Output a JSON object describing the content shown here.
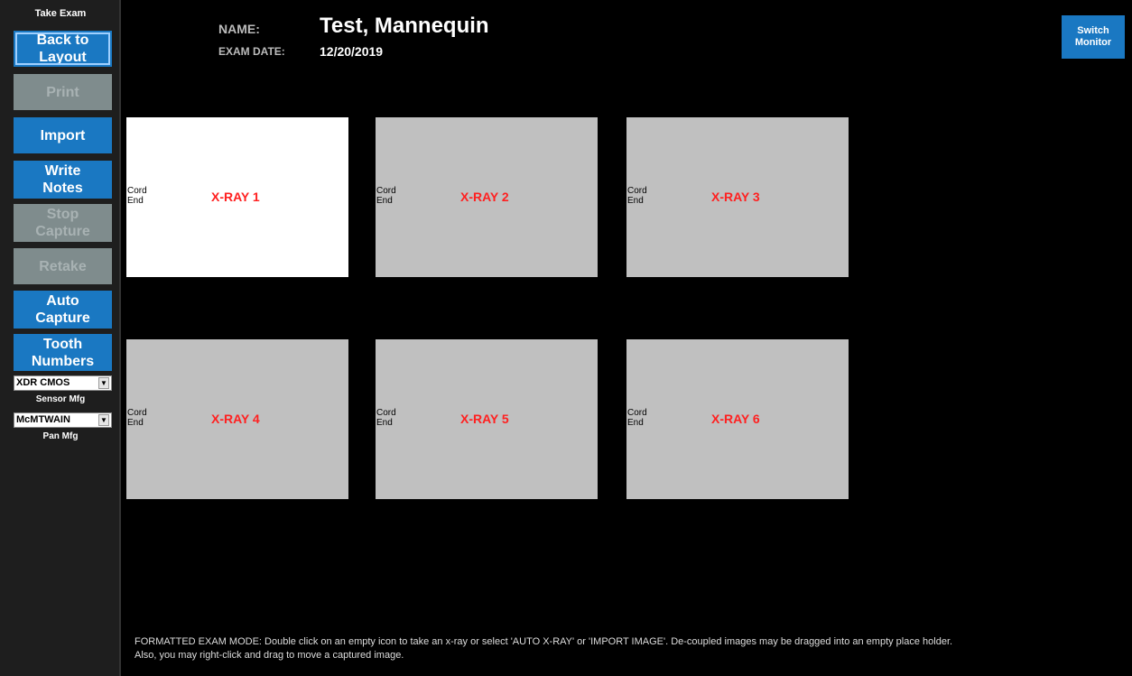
{
  "sidebar": {
    "title": "Take Exam",
    "buttons": {
      "back": "Back to\nLayout",
      "print": "Print",
      "import": "Import",
      "write_notes": "Write\nNotes",
      "stop_capture": "Stop\nCapture",
      "retake": "Retake",
      "auto_capture": "Auto\nCapture",
      "tooth_numbers": "Tooth\nNumbers"
    },
    "sensor_select": {
      "value": "XDR CMOS",
      "caption": "Sensor Mfg"
    },
    "pan_select": {
      "value": "McMTWAIN",
      "caption": "Pan Mfg"
    }
  },
  "header": {
    "name_label": "NAME:",
    "name_value": "Test, Mannequin",
    "date_label": "EXAM DATE:",
    "date_value": "12/20/2019",
    "switch_monitor": "Switch\nMonitor"
  },
  "xrays": [
    {
      "label": "X-RAY 1",
      "cord": "Cord\nEnd"
    },
    {
      "label": "X-RAY 2",
      "cord": "Cord\nEnd"
    },
    {
      "label": "X-RAY 3",
      "cord": "Cord\nEnd"
    },
    {
      "label": "X-RAY 4",
      "cord": "Cord\nEnd"
    },
    {
      "label": "X-RAY 5",
      "cord": "Cord\nEnd"
    },
    {
      "label": "X-RAY 6",
      "cord": "Cord\nEnd"
    }
  ],
  "footer": {
    "instructions": "FORMATTED EXAM MODE: Double click on an empty icon to take an x-ray or select 'AUTO X-RAY' or 'IMPORT IMAGE'. De-coupled images may be dragged into an empty place holder.\nAlso, you may right-click and drag to move a captured image."
  },
  "colors": {
    "button_blue": "#1a78c2",
    "disabled_gray": "#7f8c8d",
    "xray_label_red": "#ff2020",
    "tile_gray": "#c0c0c0"
  }
}
